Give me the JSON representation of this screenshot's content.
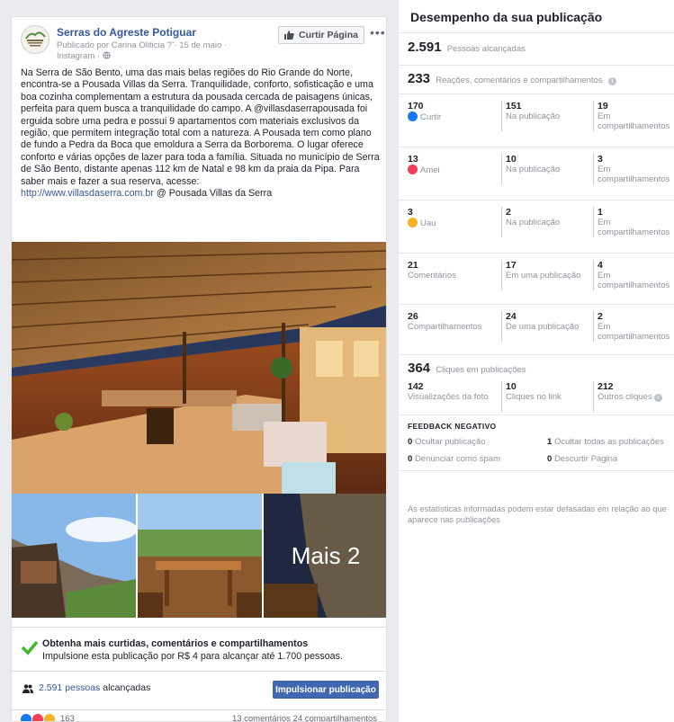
{
  "post": {
    "page_name": "Serras do Agreste Potiguar",
    "published_by": "Publicado por Carina Oliticia",
    "date": "15 de maio",
    "source": "Instagram",
    "like_page_label": "Curtir Página",
    "more_label": "•••",
    "body": "Na Serra de São Bento, uma das mais belas regiões do Rio Grande do Norte, encontra-se a Pousada Villas da Serra. Tranquilidade, conforto, sofisticação e uma boa cozinha complementam a estrutura da pousada cercada de paisagens únicas, perfeita para quem busca a tranquilidade do campo. A @villasdaserrapousada foi erguida sobre uma pedra e possui 9 apartamentos com materiais exclusivos da região, que permitem integração total com a natureza. A Pousada tem como plano de fundo a Pedra da Boca que emoldura a Serra da Borborema. O lugar oferece conforto e várias opções de lazer para toda a família. Situada no município de Serra de São Bento, distante apenas 112 km de Natal e 98 km da praia da Pipa. Para saber mais e fazer a sua reserva, acesse:",
    "link": "http://www.villasdaserra.com.br",
    "location": "@ Pousada Villas da Serra",
    "more_photos_label": "Mais 2",
    "boost_title": "Obtenha mais curtidas, comentários e compartilhamentos",
    "boost_sub": "Impulsione esta publicação por R$ 4 para alcançar até 1.700 pessoas.",
    "reach_link": "2.591 pessoas",
    "reach_suffix": "alcançadas",
    "boost_button": "Impulsionar publicação",
    "reaction_count": "163",
    "comments": "13 comentários",
    "shares": "24 compartilhamentos"
  },
  "insights": {
    "title": "Desempenho da sua publicação",
    "reached_num": "2.591",
    "reached_label": "Pessoas alcançadas",
    "engagement_num": "233",
    "engagement_label": "Reações, comentários e compartilhamentos",
    "rows": [
      {
        "n1": "170",
        "l1": "Curtir",
        "n2": "151",
        "l2": "Na publicação",
        "n3": "19",
        "l3": "Em compartilhamentos"
      },
      {
        "n1": "13",
        "l1": "Amei",
        "n2": "10",
        "l2": "Na publicação",
        "n3": "3",
        "l3": "Em compartilhamentos"
      },
      {
        "n1": "3",
        "l1": "Uau",
        "n2": "2",
        "l2": "Na publicação",
        "n3": "1",
        "l3": "Em compartilhamentos"
      },
      {
        "n1": "21",
        "l1": "Comentários",
        "n2": "17",
        "l2": "Em uma publicação",
        "n3": "4",
        "l3": "Em compartilhamentos"
      },
      {
        "n1": "26",
        "l1": "Compartilhamentos",
        "n2": "24",
        "l2": "De uma publicação",
        "n3": "2",
        "l3": "Em compartilhamentos"
      }
    ],
    "clicks_num": "364",
    "clicks_label": "Cliques em publicações",
    "clicks": {
      "n1": "142",
      "l1": "Visualizações da foto",
      "n2": "10",
      "l2": "Cliques no link",
      "n3": "212",
      "l3": "Outros cliques"
    },
    "negative_title": "FEEDBACK NEGATIVO",
    "negative": [
      {
        "n": "0",
        "label": "Ocultar publicação"
      },
      {
        "n": "1",
        "label": "Ocultar todas as publicações"
      },
      {
        "n": "0",
        "label": "Denunciar como spam"
      },
      {
        "n": "0",
        "label": "Descurtir Página"
      }
    ],
    "footnote": "As estatísticas informadas podem estar defasadas em relação ao que aparece nas publicações"
  },
  "colors": {
    "link": "#365899",
    "button_blue": "#4267b2",
    "like_blue": "#1877f2",
    "love_red": "#f33e58",
    "wow_yellow": "#f7b125",
    "check_green": "#42b72a"
  }
}
